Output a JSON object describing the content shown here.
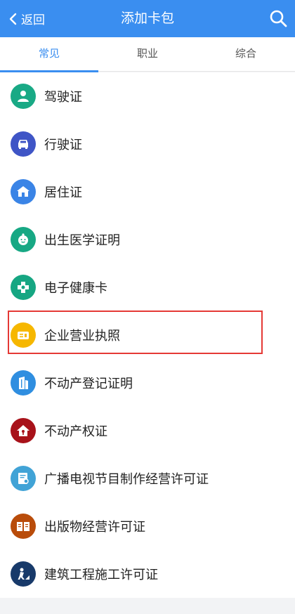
{
  "header": {
    "back_label": "返回",
    "title": "添加卡包"
  },
  "tabs": [
    {
      "label": "常见",
      "active": true
    },
    {
      "label": "职业",
      "active": false
    },
    {
      "label": "综合",
      "active": false
    }
  ],
  "items": [
    {
      "label": "驾驶证",
      "icon": "person-icon",
      "color": "#19a985"
    },
    {
      "label": "行驶证",
      "icon": "car-icon",
      "color": "#3f55c6"
    },
    {
      "label": "居住证",
      "icon": "house-icon",
      "color": "#3a84e6"
    },
    {
      "label": "出生医学证明",
      "icon": "baby-icon",
      "color": "#17a884"
    },
    {
      "label": "电子健康卡",
      "icon": "medical-cross-icon",
      "color": "#16a682"
    },
    {
      "label": "企业营业执照",
      "icon": "business-card-icon",
      "color": "#f6b700",
      "highlighted": true
    },
    {
      "label": "不动产登记证明",
      "icon": "building-icon",
      "color": "#2f8ee0"
    },
    {
      "label": "不动产权证",
      "icon": "home-lock-icon",
      "color": "#a8121a"
    },
    {
      "label": "广播电视节目制作经营许可证",
      "icon": "certificate-icon",
      "color": "#41a3d6"
    },
    {
      "label": "出版物经营许可证",
      "icon": "book-icon",
      "color": "#b94c0a"
    },
    {
      "label": "建筑工程施工许可证",
      "icon": "construction-worker-icon",
      "color": "#183a6a"
    }
  ]
}
